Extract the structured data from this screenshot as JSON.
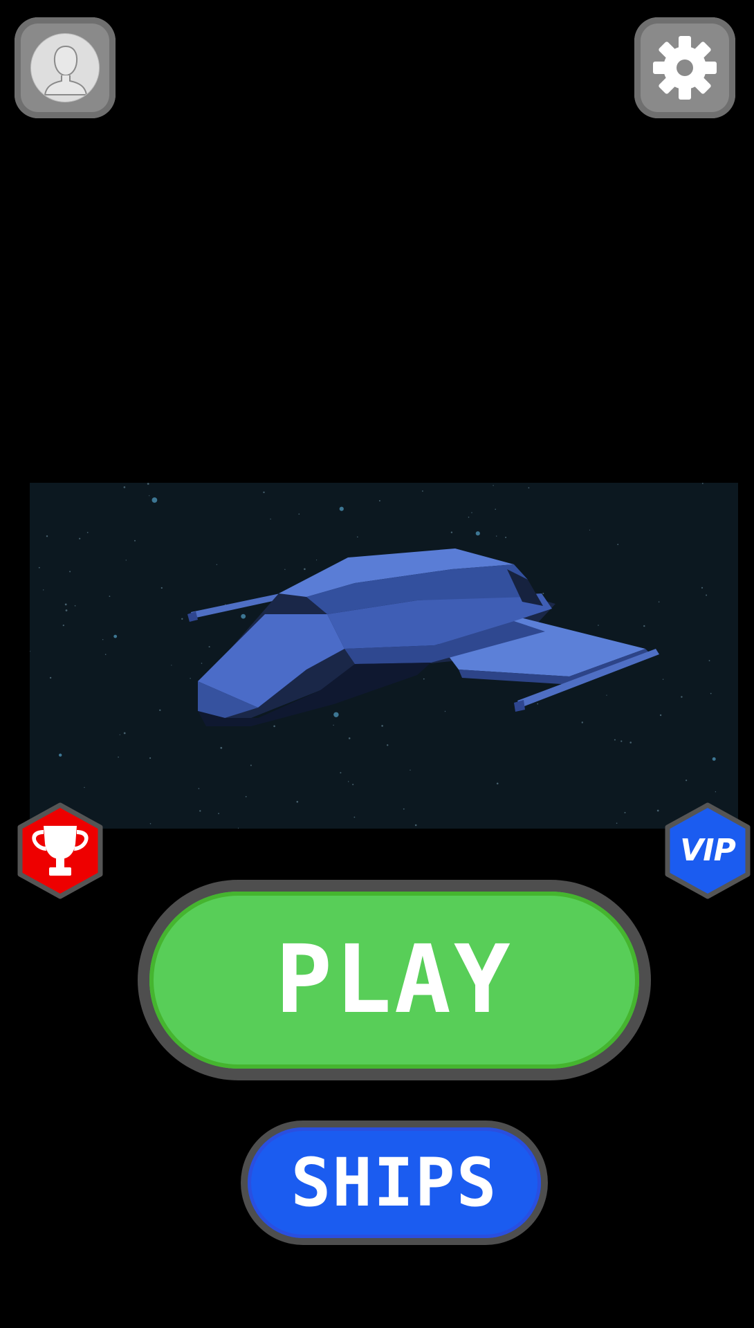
{
  "header": {
    "profile_icon": "user-silhouette-icon",
    "settings_icon": "gear-icon"
  },
  "showcase": {
    "subject": "spaceship-3d-model",
    "colors": {
      "background": "#0c1820",
      "ship_hull": "#3d5fb5",
      "ship_highlight": "#5a7fd6",
      "ship_shadow": "#141d33"
    }
  },
  "side_buttons": {
    "trophy_icon": "trophy-icon",
    "trophy_color": "#ee0000",
    "vip_label": "VIP",
    "vip_color": "#1b5cf0"
  },
  "actions": {
    "play_label": "PLAY",
    "play_color": "#58ce58",
    "ships_label": "SHIPS",
    "ships_color": "#1b5cf0"
  }
}
